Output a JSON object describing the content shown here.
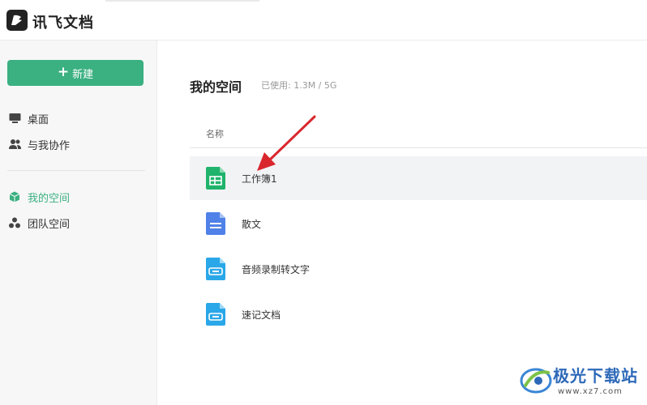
{
  "app": {
    "title": "讯飞文档"
  },
  "sidebar": {
    "new_button": {
      "plus": "+",
      "label": "新建"
    },
    "items": [
      {
        "label": "桌面",
        "icon": "desktop-icon"
      },
      {
        "label": "与我协作",
        "icon": "users-icon"
      },
      {
        "label": "我的空间",
        "icon": "cube-icon",
        "active": true
      },
      {
        "label": "团队空间",
        "icon": "team-icon"
      }
    ]
  },
  "main": {
    "title": "我的空间",
    "usage": "已使用: 1.3M  /  5G",
    "column_name": "名称",
    "files": [
      {
        "name": "工作簿1",
        "type": "spreadsheet",
        "color": "#1fb36b"
      },
      {
        "name": "散文",
        "type": "document",
        "color": "#4f81e8"
      },
      {
        "name": "音频录制转文字",
        "type": "audio-transcript",
        "color": "#2aa7e8"
      },
      {
        "name": "速记文档",
        "type": "shorthand",
        "color": "#2aa7e8"
      }
    ]
  },
  "colors": {
    "accent": "#3bb081",
    "arrow": "#d9262c"
  },
  "watermark": {
    "name": "极光下载站",
    "url": "www.xz7.com"
  }
}
